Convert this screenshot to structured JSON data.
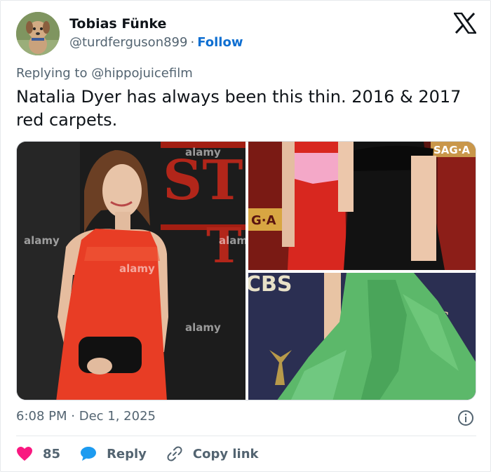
{
  "user": {
    "name": "Tobias Fünke",
    "handle": "@turdferguson899",
    "separator": "·",
    "follow_label": "Follow"
  },
  "reply": {
    "prefix": "Replying to ",
    "target": "@hippojuicefilm"
  },
  "tweet": {
    "text": "Natalia Dyer has always been this thin. 2016 & 2017 red carpets."
  },
  "media": {
    "watermark": "alamy",
    "images": [
      {
        "description_icon": "red-lace-dress-photo",
        "sign_text_1": "ST",
        "sign_text_2": "T"
      },
      {
        "description_icon": "red-dress-flower-trim-photo",
        "banner_text_1": "SAG·A",
        "banner_text_2": "G·A"
      },
      {
        "description_icon": "green-gown-photo",
        "logo_text": "CBS"
      }
    ]
  },
  "meta": {
    "time": "6:08 PM",
    "separator": "·",
    "date": "Dec 1, 2025"
  },
  "actions": {
    "likes_count": "85",
    "reply_label": "Reply",
    "copy_link_label": "Copy link"
  },
  "colors": {
    "accent": "#0f6fd1",
    "like": "#f91880",
    "reply_bubble": "#1d9bf0",
    "muted_text": "#536471"
  }
}
